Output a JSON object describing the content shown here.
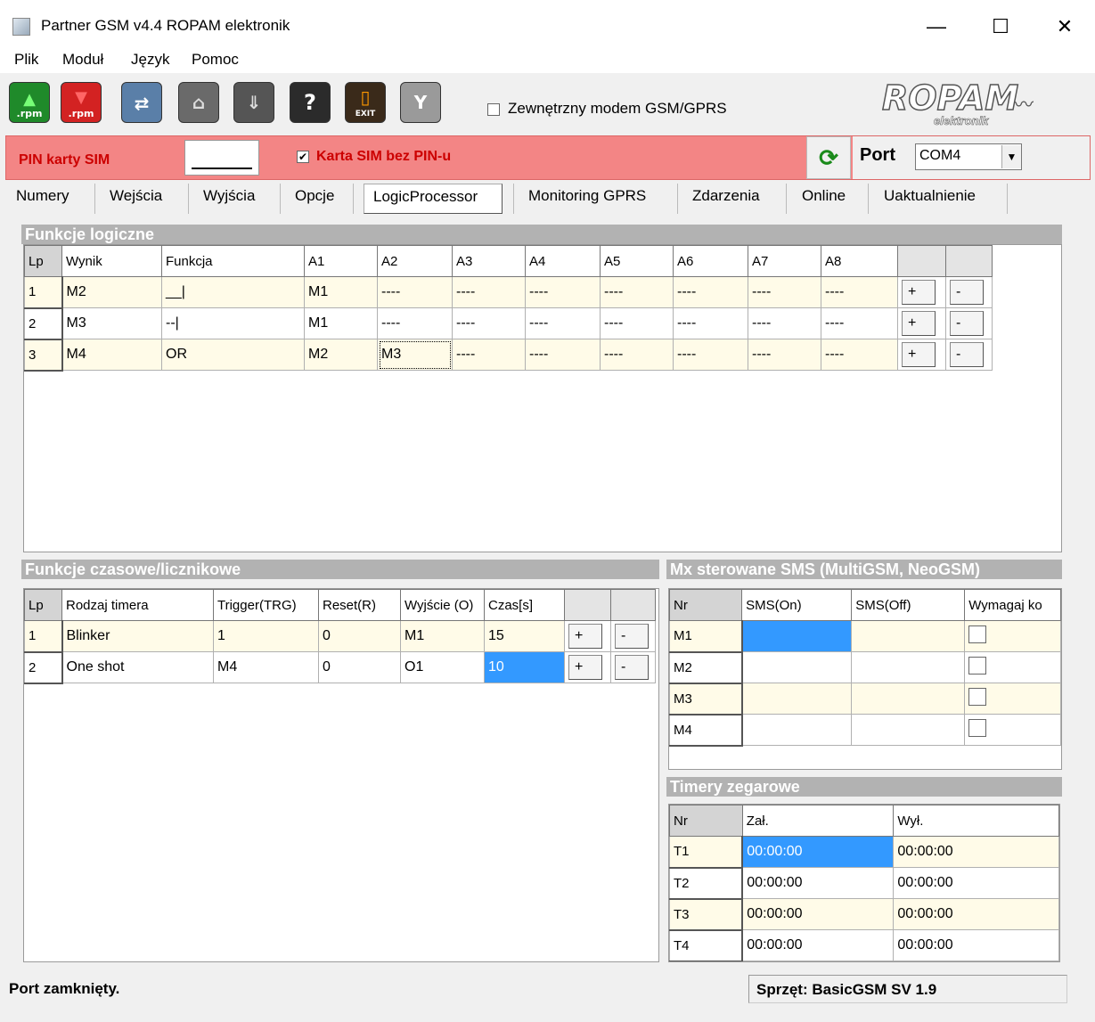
{
  "window": {
    "title": "Partner GSM v4.4 ROPAM elektronik",
    "minimize": "—",
    "maximize": "☐",
    "close": "✕"
  },
  "menu": [
    "Plik",
    "Moduł",
    "Język",
    "Pomoc"
  ],
  "toolbar": {
    "buttons": [
      {
        "name": "open-rpm",
        "label": ".rpm",
        "color": "#1f8a2a"
      },
      {
        "name": "save-rpm",
        "label": ".rpm",
        "color": "#d32222"
      },
      {
        "name": "connect-module",
        "label": "",
        "color": "#5a7fa8"
      },
      {
        "name": "read-module",
        "label": "",
        "color": "#6a6a6a"
      },
      {
        "name": "write-module",
        "label": "",
        "color": "#555555"
      },
      {
        "name": "help",
        "label": "?",
        "color": "#2b2b2b"
      },
      {
        "name": "exit",
        "label": "EXIT",
        "color": "#3a2a1a"
      },
      {
        "name": "gsm-signal",
        "label": "",
        "color": "#9a9a9a"
      }
    ],
    "external_modem_label": "Zewnętrzny modem GSM/GPRS",
    "logo_text": "ROPAM",
    "logo_sub": "elektronik"
  },
  "pin": {
    "label": "PIN karty SIM",
    "value": "",
    "nopin_label": "Karta SIM bez PIN-u",
    "nopin_checked": "✔",
    "port_label": "Port",
    "port_value": "COM4"
  },
  "tabs": [
    "Numery",
    "Wejścia",
    "Wyjścia",
    "Opcje",
    "LogicProcessor",
    "Monitoring GPRS",
    "Zdarzenia",
    "Online",
    "Uaktualnienie"
  ],
  "logic": {
    "title": "Funkcje logiczne",
    "headers": [
      "Lp",
      "Wynik",
      "Funkcja",
      "A1",
      "A2",
      "A3",
      "A4",
      "A5",
      "A6",
      "A7",
      "A8",
      "",
      ""
    ],
    "rows": [
      [
        "1",
        "M2",
        "__|",
        "M1",
        "----",
        "----",
        "----",
        "----",
        "----",
        "----",
        "----"
      ],
      [
        "2",
        "M3",
        "--|",
        "M1",
        "----",
        "----",
        "----",
        "----",
        "----",
        "----",
        "----"
      ],
      [
        "3",
        "M4",
        "OR",
        "M2",
        "M3",
        "----",
        "----",
        "----",
        "----",
        "----",
        "----"
      ]
    ],
    "plus": "+",
    "minus": "-"
  },
  "timers": {
    "title": "Funkcje czasowe/licznikowe",
    "headers": [
      "Lp",
      "Rodzaj timera",
      "Trigger(TRG)",
      "Reset(R)",
      "Wyjście (O)",
      "Czas[s]",
      "",
      ""
    ],
    "rows": [
      [
        "1",
        "Blinker",
        "1",
        "0",
        "M1",
        "15"
      ],
      [
        "2",
        "One shot",
        "M4",
        "0",
        "O1",
        "10"
      ]
    ],
    "plus": "+",
    "minus": "-"
  },
  "sms": {
    "title": "Mx sterowane SMS (MultiGSM, NeoGSM)",
    "headers": [
      "Nr",
      "SMS(On)",
      "SMS(Off)",
      "Wymagaj ko"
    ],
    "rows": [
      "M1",
      "M2",
      "M3",
      "M4"
    ]
  },
  "clock": {
    "title": "Timery zegarowe",
    "headers": [
      "Nr",
      "Zał.",
      "Wył."
    ],
    "rows": [
      [
        "T1",
        "00:00:00",
        "00:00:00"
      ],
      [
        "T2",
        "00:00:00",
        "00:00:00"
      ],
      [
        "T3",
        "00:00:00",
        "00:00:00"
      ],
      [
        "T4",
        "00:00:00",
        "00:00:00"
      ]
    ]
  },
  "status": {
    "left": "Port zamknięty.",
    "right": "Sprzęt: BasicGSM SV 1.9"
  }
}
